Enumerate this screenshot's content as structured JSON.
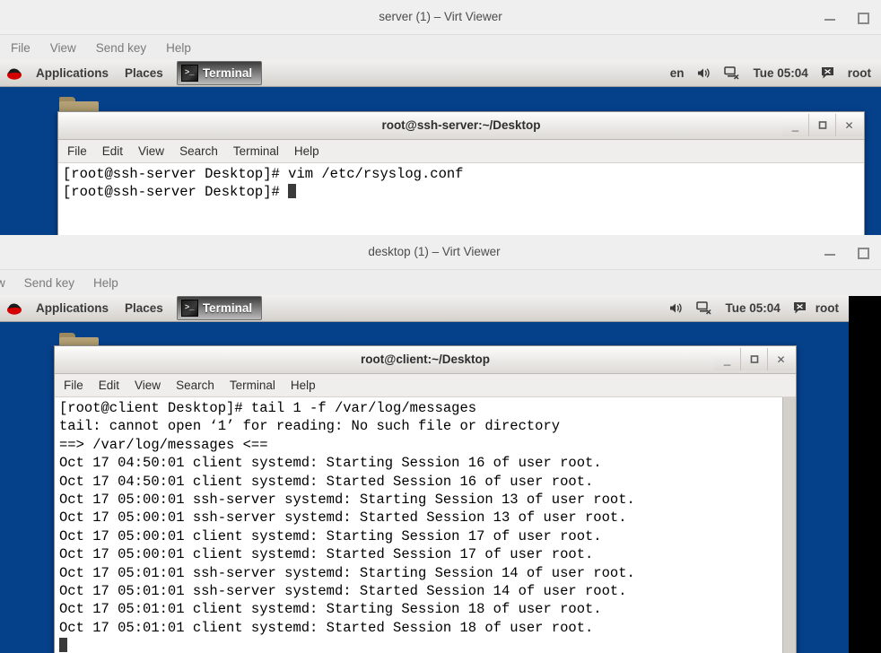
{
  "viewer_top": {
    "window_title": "server (1) – Virt Viewer",
    "window_buttons": {
      "minimize": "–",
      "restore": "❐"
    },
    "menu": [
      "File",
      "View",
      "Send key",
      "Help"
    ],
    "panel": {
      "applications": "Applications",
      "places": "Places",
      "task_button": "Terminal",
      "task_icon": ">_",
      "tray": {
        "keyboard_layout": "en",
        "clock": "Tue 05:04",
        "user": "root"
      }
    },
    "terminal": {
      "title": "root@ssh-server:~/Desktop",
      "menu": [
        "File",
        "Edit",
        "View",
        "Search",
        "Terminal",
        "Help"
      ],
      "controls": {
        "minimize": "_",
        "maximize": "❐",
        "close": "✕"
      },
      "lines": [
        "[root@ssh-server Desktop]# vim /etc/rsyslog.conf",
        "[root@ssh-server Desktop]# "
      ],
      "cursor_on_last_line": true
    }
  },
  "viewer_bottom": {
    "window_title": "desktop (1) – Virt Viewer",
    "window_buttons": {
      "minimize": "–",
      "restore": "❐"
    },
    "menu": [
      "w",
      "Send key",
      "Help"
    ],
    "panel": {
      "applications": "Applications",
      "places": "Places",
      "task_button": "Terminal",
      "task_icon": ">_",
      "tray": {
        "clock": "Tue 05:04",
        "user": "root"
      }
    },
    "terminal": {
      "title": "root@client:~/Desktop",
      "menu": [
        "File",
        "Edit",
        "View",
        "Search",
        "Terminal",
        "Help"
      ],
      "controls": {
        "minimize": "_",
        "maximize": "❐",
        "close": "✕"
      },
      "lines": [
        "[root@client Desktop]# tail 1 -f /var/log/messages",
        "tail: cannot open ‘1’ for reading: No such file or directory",
        "==> /var/log/messages <==",
        "Oct 17 04:50:01 client systemd: Starting Session 16 of user root.",
        "Oct 17 04:50:01 client systemd: Started Session 16 of user root.",
        "Oct 17 05:00:01 ssh-server systemd: Starting Session 13 of user root.",
        "Oct 17 05:00:01 ssh-server systemd: Started Session 13 of user root.",
        "Oct 17 05:00:01 client systemd: Starting Session 17 of user root.",
        "Oct 17 05:00:01 client systemd: Started Session 17 of user root.",
        "Oct 17 05:01:01 ssh-server systemd: Starting Session 14 of user root.",
        "Oct 17 05:01:01 ssh-server systemd: Started Session 14 of user root.",
        "Oct 17 05:01:01 client systemd: Starting Session 18 of user root.",
        "Oct 17 05:01:01 client systemd: Started Session 18 of user root."
      ],
      "cursor_on_last_line": true
    }
  },
  "colors": {
    "desktop_blue": "#05408a",
    "panel_gray": "#e3e1de",
    "terminal_bg": "#ffffff",
    "terminal_fg": "#000000",
    "chrome_gray": "#ededed"
  }
}
